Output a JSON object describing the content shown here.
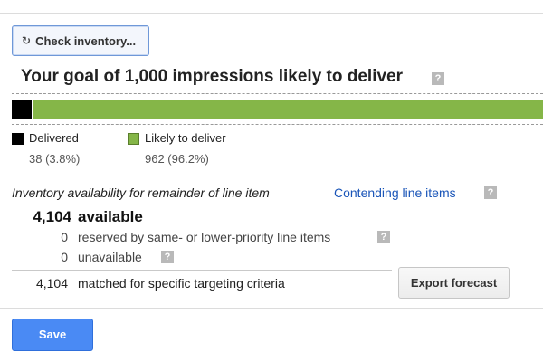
{
  "toolbar": {
    "check_inventory_icon": "refresh-icon",
    "check_inventory_label": "Check inventory..."
  },
  "goal": {
    "title": "Your goal of 1,000 impressions likely to deliver",
    "help_glyph": "?"
  },
  "delivery_bar": {
    "delivered_fraction": 0.038,
    "likely_fraction": 0.962,
    "delivered_color": "#000000",
    "likely_color": "#85b648"
  },
  "legend": {
    "delivered": {
      "label": "Delivered",
      "value": "38 (3.8%)"
    },
    "likely": {
      "label": "Likely to deliver",
      "value": "962 (96.2%)"
    }
  },
  "inventory": {
    "caption": "Inventory availability for remainder of line item",
    "contending_link": "Contending line items",
    "available": {
      "number": "4,104",
      "label": "available"
    },
    "reserved": {
      "number": "0",
      "label": "reserved by same- or lower-priority line items"
    },
    "unavailable": {
      "number": "0",
      "label": "unavailable"
    },
    "matched": {
      "number": "4,104",
      "label": "matched for specific targeting criteria"
    },
    "export_label": "Export forecast"
  },
  "footer": {
    "save_label": "Save"
  },
  "colors": {
    "link": "#1a55b8",
    "primary_button": "#4a8af4",
    "help_badge": "#b9b9b9"
  }
}
